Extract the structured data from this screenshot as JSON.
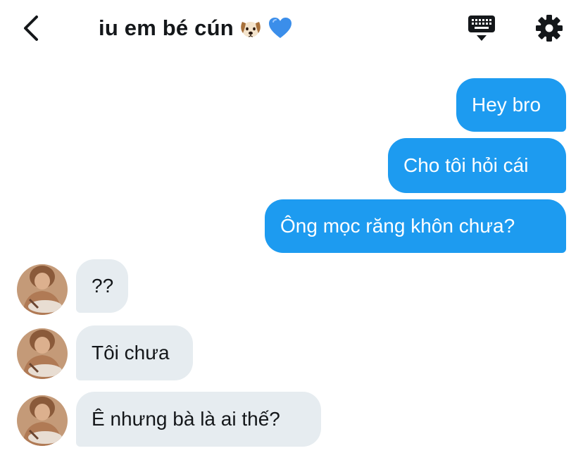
{
  "header": {
    "title": "iu em bé cún",
    "title_emojis": [
      "dog-face-icon",
      "blue-heart-icon"
    ],
    "back_icon": "chevron-left-icon",
    "keyboard_icon": "keyboard-icon",
    "settings_icon": "gear-icon"
  },
  "colors": {
    "outgoing_bubble": "#1d9bf0",
    "incoming_bubble": "#e6ecf0",
    "text_dark": "#14171a"
  },
  "messages": {
    "m1": {
      "direction": "outgoing",
      "text": "Hey bro"
    },
    "m2": {
      "direction": "outgoing",
      "text": "Cho tôi hỏi cái"
    },
    "m3": {
      "direction": "outgoing",
      "text": "Ông mọc răng khôn chưa?"
    },
    "m4": {
      "direction": "incoming",
      "text": "??"
    },
    "m5": {
      "direction": "incoming",
      "text": "Tôi chưa"
    },
    "m6": {
      "direction": "incoming",
      "text": "Ê nhưng bà là ai thế?"
    }
  }
}
